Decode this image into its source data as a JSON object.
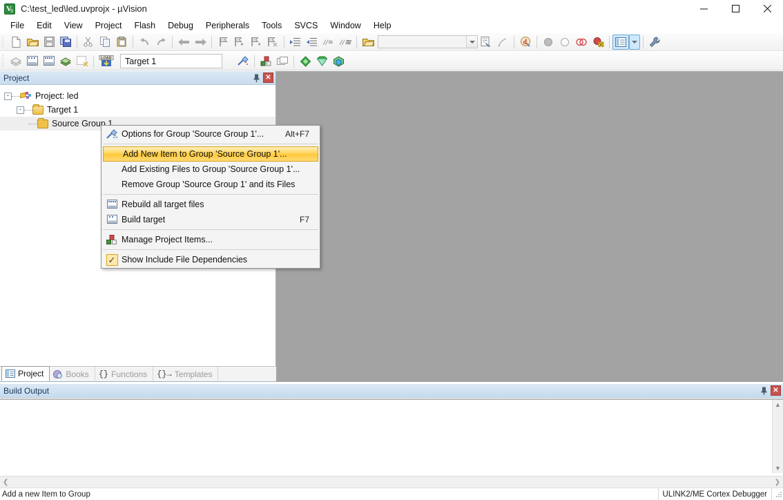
{
  "window": {
    "title": "C:\\test_led\\led.uvprojx - µVision",
    "app_icon": "uvision-icon",
    "controls": {
      "minimize": "minimize-icon",
      "maximize": "maximize-icon",
      "close": "close-icon"
    }
  },
  "menubar": {
    "items": [
      {
        "label": "File"
      },
      {
        "label": "Edit"
      },
      {
        "label": "View"
      },
      {
        "label": "Project"
      },
      {
        "label": "Flash"
      },
      {
        "label": "Debug"
      },
      {
        "label": "Peripherals"
      },
      {
        "label": "Tools"
      },
      {
        "label": "SVCS"
      },
      {
        "label": "Window"
      },
      {
        "label": "Help"
      }
    ]
  },
  "toolbar_main": {
    "buttons": [
      {
        "name": "new-file-icon"
      },
      {
        "name": "open-file-icon"
      },
      {
        "name": "save-icon"
      },
      {
        "name": "save-all-icon"
      },
      {
        "name": "cut-icon"
      },
      {
        "name": "copy-icon"
      },
      {
        "name": "paste-icon"
      },
      {
        "name": "undo-icon"
      },
      {
        "name": "redo-icon"
      },
      {
        "name": "navigate-backward-icon"
      },
      {
        "name": "navigate-forward-icon"
      },
      {
        "name": "bookmark-toggle-icon"
      },
      {
        "name": "bookmark-prev-icon"
      },
      {
        "name": "bookmark-next-icon"
      },
      {
        "name": "bookmark-clear-icon"
      },
      {
        "name": "indent-icon"
      },
      {
        "name": "outdent-icon"
      },
      {
        "name": "comment-icon"
      },
      {
        "name": "uncomment-icon"
      },
      {
        "name": "open-folder-icon"
      }
    ],
    "find_combo": {
      "value": "",
      "placeholder": ""
    },
    "after_buttons": [
      {
        "name": "find-in-files-icon"
      },
      {
        "name": "incremental-find-icon"
      },
      {
        "name": "configure-icon"
      },
      {
        "name": "breakpoint-insert-icon"
      },
      {
        "name": "breakpoint-kill-icon"
      },
      {
        "name": "breakpoint-disable-icon"
      },
      {
        "name": "breakpoint-disable-all-icon"
      },
      {
        "name": "window-layout-icon"
      },
      {
        "name": "layout-dropdown-icon"
      },
      {
        "name": "settings-wrench-icon"
      }
    ]
  },
  "toolbar_build": {
    "buttons": [
      {
        "name": "translate-icon"
      },
      {
        "name": "build-icon"
      },
      {
        "name": "rebuild-icon"
      },
      {
        "name": "batch-build-icon"
      },
      {
        "name": "stop-build-icon"
      },
      {
        "name": "download-load-icon"
      }
    ],
    "target_combo": {
      "value": "Target 1"
    },
    "after_buttons": [
      {
        "name": "target-options-icon"
      },
      {
        "name": "manage-project-items-icon"
      },
      {
        "name": "multi-project-icon"
      },
      {
        "name": "pack-installer-icon"
      },
      {
        "name": "manage-run-time-environment-icon"
      },
      {
        "name": "software-packs-icon"
      }
    ]
  },
  "project_panel": {
    "caption": "Project",
    "pin_icon": "pin-icon",
    "close_icon": "close-icon",
    "tree": [
      {
        "label": "Project: led",
        "icon": "project-icon",
        "expander": "-",
        "level": 0
      },
      {
        "label": "Target 1",
        "icon": "folder-target-icon",
        "expander": "-",
        "level": 1
      },
      {
        "label": "Source Group 1",
        "icon": "folder-icon",
        "expander": "",
        "level": 2,
        "selected": true
      }
    ],
    "tabs": [
      {
        "label": "Project",
        "icon": "project-tab-icon",
        "selected": true
      },
      {
        "label": "Books",
        "icon": "books-tab-icon",
        "selected": false
      },
      {
        "label": "Functions",
        "icon": "functions-tab-icon",
        "selected": false
      },
      {
        "label": "Templates",
        "icon": "templates-tab-icon",
        "selected": false
      }
    ]
  },
  "context_menu": {
    "items": [
      {
        "label": "Options for Group 'Source Group 1'...",
        "accel": "Alt+F7",
        "icon": "options-wand-icon",
        "highlight": false
      },
      {
        "separator": true
      },
      {
        "label": "Add New  Item to Group 'Source Group 1'...",
        "accel": "",
        "icon": "",
        "highlight": true
      },
      {
        "label": "Add Existing Files to Group 'Source Group 1'...",
        "accel": "",
        "icon": "",
        "highlight": false
      },
      {
        "label": "Remove Group 'Source Group 1' and its Files",
        "accel": "",
        "icon": "",
        "highlight": false
      },
      {
        "separator": true
      },
      {
        "label": "Rebuild all target files",
        "accel": "",
        "icon": "rebuild-icon",
        "highlight": false
      },
      {
        "label": "Build target",
        "accel": "F7",
        "icon": "build-icon",
        "highlight": false
      },
      {
        "separator": true
      },
      {
        "label": "Manage Project Items...",
        "accel": "",
        "icon": "manage-items-icon",
        "highlight": false
      },
      {
        "separator": true
      },
      {
        "label": "Show Include File Dependencies",
        "accel": "",
        "icon": "checkmark-icon",
        "highlight": false
      }
    ],
    "highlight_color": "#ffc93a"
  },
  "build_output": {
    "caption": "Build Output",
    "pin_icon": "pin-icon",
    "close_icon": "close-icon",
    "content": "",
    "scroll_up_icon": "scroll-up-icon",
    "scroll_down_icon": "scroll-down-icon",
    "scroll_left_icon": "scroll-left-icon",
    "scroll_right_icon": "scroll-right-icon"
  },
  "statusbar": {
    "message": "Add a new Item to Group",
    "debugger": "ULINK2/ME Cortex Debugger"
  }
}
